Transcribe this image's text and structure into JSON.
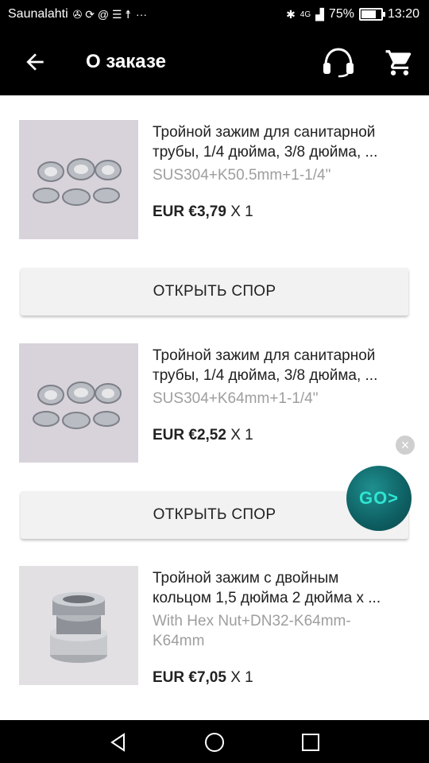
{
  "status_bar": {
    "carrier": "Saunalahti",
    "icons_left": [
      "notification-icons",
      "more-dots"
    ],
    "more": "···",
    "network": "4G",
    "battery": "75%",
    "battery_level": 0.75,
    "time": "13:20"
  },
  "app_bar": {
    "title": "О заказе",
    "icons": [
      "back-arrow-icon",
      "headset-icon",
      "cart-icon"
    ]
  },
  "items": [
    {
      "name_line1": "Тройной зажим для санитарной",
      "name_line2": "трубы, 1/4 дюйма, 3/8 дюйма, ...",
      "variant": "SUS304+K50.5mm+1-1/4\"",
      "price": "EUR €3,79",
      "qty": "X 1",
      "button": "ОТКРЫТЬ СПОР"
    },
    {
      "name_line1": "Тройной зажим для санитарной",
      "name_line2": "трубы, 1/4 дюйма, 3/8 дюйма, ...",
      "variant": "SUS304+K64mm+1-1/4\"",
      "price": "EUR €2,52",
      "qty": "X 1",
      "button": "ОТКРЫТЬ СПОР"
    },
    {
      "name_line1": "Тройной зажим с двойным",
      "name_line2": "кольцом 1,5 дюйма 2 дюйма х ...",
      "variant_line1": "With Hex Nut+DN32-K64mm-",
      "variant_line2": "K64mm",
      "price": "EUR €7,05",
      "qty": "X 1"
    }
  ],
  "floating": {
    "go_label": "GO>",
    "close": "×"
  },
  "nav_bar": {
    "icons": [
      "back-triangle-icon",
      "home-circle-icon",
      "recents-square-icon"
    ]
  }
}
